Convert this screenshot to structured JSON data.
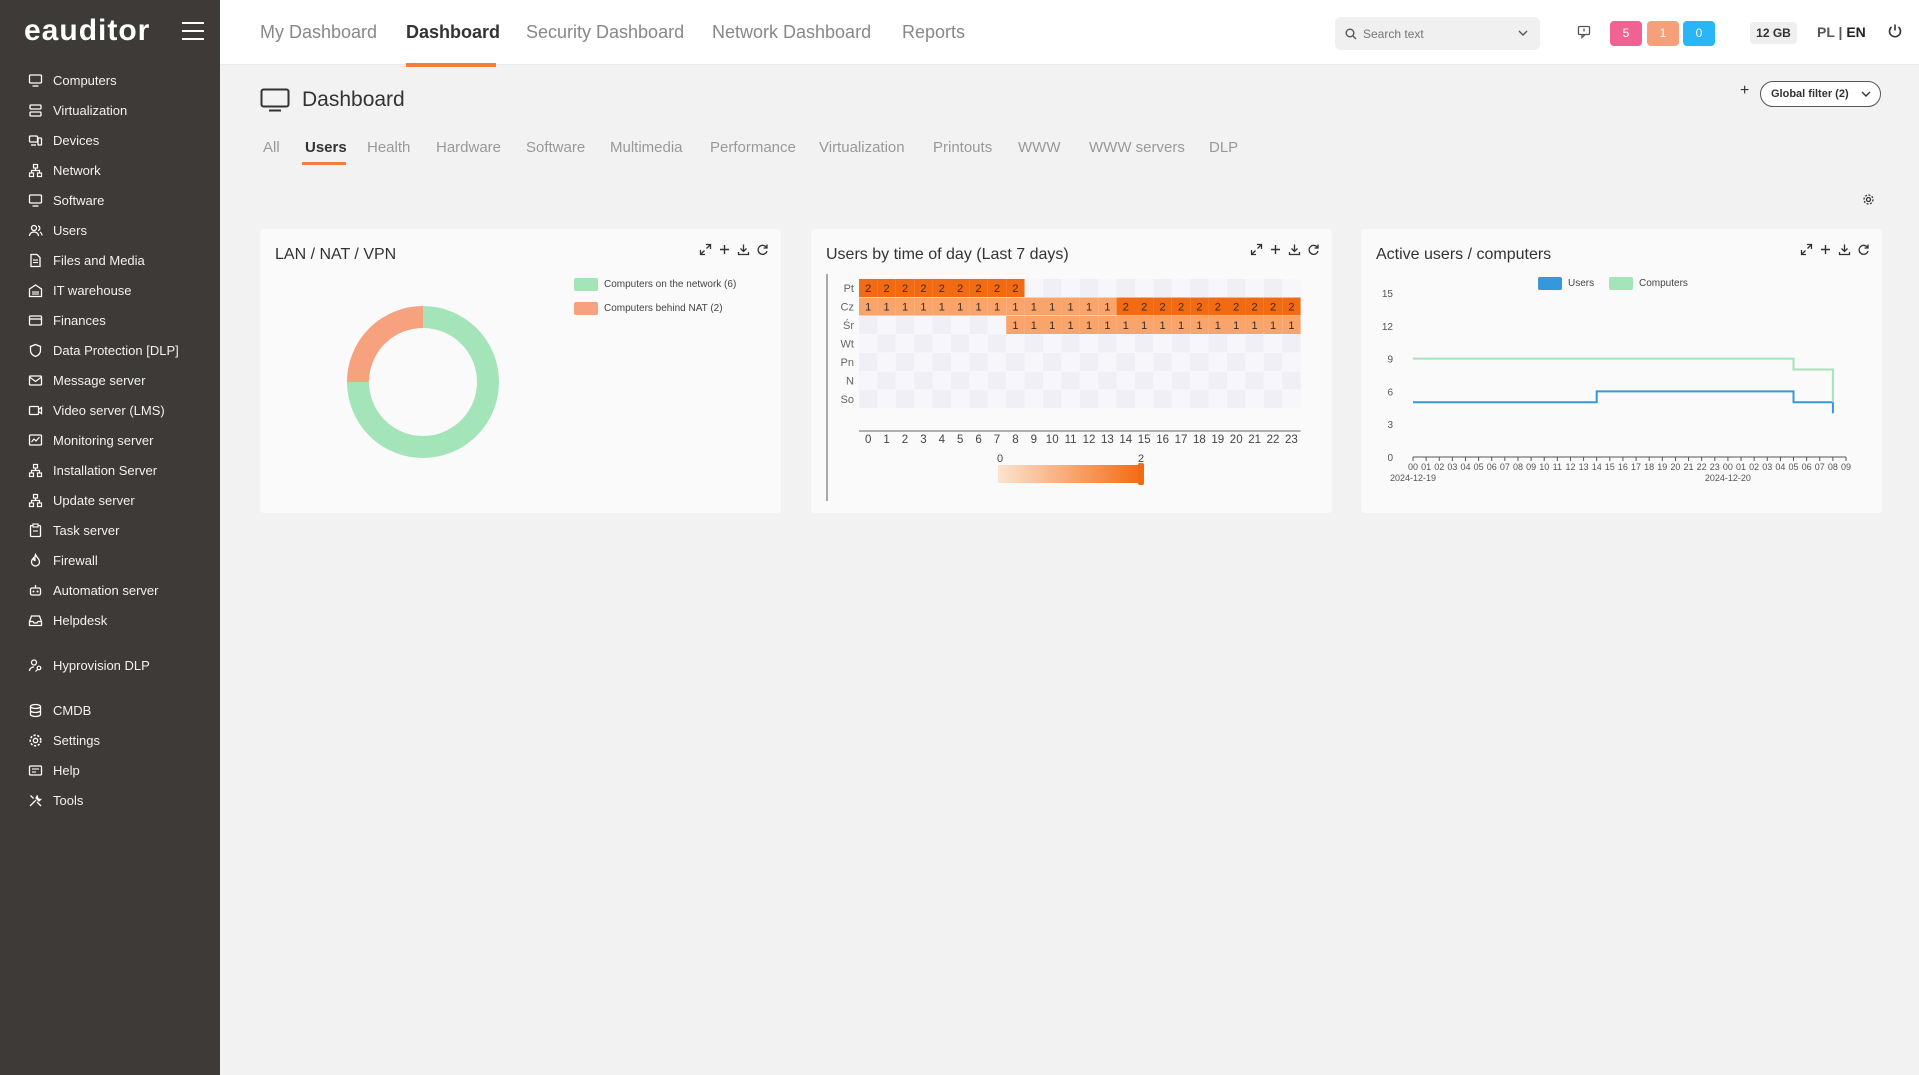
{
  "app": {
    "logo": "eauditor"
  },
  "sidebar": {
    "items": [
      {
        "label": "Computers",
        "icon": "monitor-icon"
      },
      {
        "label": "Virtualization",
        "icon": "server-icon"
      },
      {
        "label": "Devices",
        "icon": "devices-icon"
      },
      {
        "label": "Network",
        "icon": "network-icon"
      },
      {
        "label": "Software",
        "icon": "monitor-icon"
      },
      {
        "label": "Users",
        "icon": "users-icon"
      },
      {
        "label": "Files and Media",
        "icon": "file-icon"
      },
      {
        "label": "IT warehouse",
        "icon": "warehouse-icon"
      },
      {
        "label": "Finances",
        "icon": "card-icon"
      },
      {
        "label": "Data Protection [DLP]",
        "icon": "shield-icon"
      },
      {
        "label": "Message server",
        "icon": "mail-icon"
      },
      {
        "label": "Video server (LMS)",
        "icon": "video-icon"
      },
      {
        "label": "Monitoring server",
        "icon": "chart-icon"
      },
      {
        "label": "Installation Server",
        "icon": "network-icon"
      },
      {
        "label": "Update server",
        "icon": "network-icon"
      },
      {
        "label": "Task server",
        "icon": "clipboard-icon"
      },
      {
        "label": "Firewall",
        "icon": "fire-icon"
      },
      {
        "label": "Automation server",
        "icon": "robot-icon"
      },
      {
        "label": "Helpdesk",
        "icon": "inbox-icon"
      }
    ],
    "items2": [
      {
        "label": "Hyprovision DLP",
        "icon": "user-key-icon"
      }
    ],
    "items3": [
      {
        "label": "CMDB",
        "icon": "database-icon"
      },
      {
        "label": "Settings",
        "icon": "gear-icon"
      },
      {
        "label": "Help",
        "icon": "help-icon"
      },
      {
        "label": "Tools",
        "icon": "tools-icon"
      }
    ]
  },
  "topnav": {
    "tabs": [
      "My Dashboard",
      "Dashboard",
      "Security Dashboard",
      "Network Dashboard",
      "Reports"
    ],
    "active": "Dashboard",
    "search_placeholder": "Search text",
    "badges": [
      {
        "value": "5",
        "color": "#f06292"
      },
      {
        "value": "1",
        "color": "#f4a07a"
      },
      {
        "value": "0",
        "color": "#29b6f6"
      }
    ],
    "storage": "12 GB",
    "lang_pl": "PL",
    "lang_sep": " | ",
    "lang_en": "EN"
  },
  "page": {
    "title": "Dashboard",
    "global_filter": "Global filter (2)",
    "subtabs": [
      "All",
      "Users",
      "Health",
      "Hardware",
      "Software",
      "Multimedia",
      "Performance",
      "Virtualization",
      "Printouts",
      "WWW",
      "WWW servers",
      "DLP"
    ],
    "active_subtab": "Users"
  },
  "widgets": {
    "lan": {
      "title": "LAN / NAT / VPN"
    },
    "time": {
      "title": "Users by time of day (Last 7 days)"
    },
    "active": {
      "title": "Active users / computers"
    }
  },
  "colors": {
    "accent": "#f47c3c",
    "green": "#a3e4b8",
    "salmon": "#f7a27f",
    "blue": "#3498db",
    "heat_dark": "#f26a12",
    "heat_light": "#f9a46b"
  },
  "chart_data": [
    {
      "type": "pie",
      "title": "LAN / NAT / VPN",
      "donut": true,
      "legend_position": "top-right",
      "slices": [
        {
          "label": "Computers on the network (6)",
          "value": 6,
          "color": "#a3e4b8"
        },
        {
          "label": "Computers behind NAT (2)",
          "value": 2,
          "color": "#f7a27f"
        }
      ]
    },
    {
      "type": "heatmap",
      "title": "Users by time of day (Last 7 days)",
      "x": [
        "0",
        "1",
        "2",
        "3",
        "4",
        "5",
        "6",
        "7",
        "8",
        "9",
        "10",
        "11",
        "12",
        "13",
        "14",
        "15",
        "16",
        "17",
        "18",
        "19",
        "20",
        "21",
        "22",
        "23"
      ],
      "y": [
        "Pt",
        "Cz",
        "Śr",
        "Wt",
        "Pn",
        "N",
        "So"
      ],
      "rows": [
        [
          2,
          2,
          2,
          2,
          2,
          2,
          2,
          2,
          2,
          null,
          null,
          null,
          null,
          null,
          null,
          null,
          null,
          null,
          null,
          null,
          null,
          null,
          null,
          null
        ],
        [
          1,
          1,
          1,
          1,
          1,
          1,
          1,
          1,
          1,
          1,
          1,
          1,
          1,
          1,
          2,
          2,
          2,
          2,
          2,
          2,
          2,
          2,
          2,
          2
        ],
        [
          null,
          null,
          null,
          null,
          null,
          null,
          null,
          null,
          1,
          1,
          1,
          1,
          1,
          1,
          1,
          1,
          1,
          1,
          1,
          1,
          1,
          1,
          1,
          1
        ],
        [
          null,
          null,
          null,
          null,
          null,
          null,
          null,
          null,
          null,
          null,
          null,
          null,
          null,
          null,
          null,
          null,
          null,
          null,
          null,
          null,
          null,
          null,
          null,
          null
        ],
        [
          null,
          null,
          null,
          null,
          null,
          null,
          null,
          null,
          null,
          null,
          null,
          null,
          null,
          null,
          null,
          null,
          null,
          null,
          null,
          null,
          null,
          null,
          null,
          null
        ],
        [
          null,
          null,
          null,
          null,
          null,
          null,
          null,
          null,
          null,
          null,
          null,
          null,
          null,
          null,
          null,
          null,
          null,
          null,
          null,
          null,
          null,
          null,
          null,
          null
        ],
        [
          null,
          null,
          null,
          null,
          null,
          null,
          null,
          null,
          null,
          null,
          null,
          null,
          null,
          null,
          null,
          null,
          null,
          null,
          null,
          null,
          null,
          null,
          null,
          null
        ]
      ],
      "visual_map": {
        "min": "0",
        "max": "2"
      }
    },
    {
      "type": "line",
      "title": "Active users / computers",
      "ylim": [
        0,
        15
      ],
      "y_ticks": [
        "0",
        "3",
        "6",
        "9",
        "12",
        "15"
      ],
      "x_ticks": [
        "00",
        "01",
        "02",
        "03",
        "04",
        "05",
        "06",
        "07",
        "08",
        "09",
        "10",
        "11",
        "12",
        "13",
        "14",
        "15",
        "16",
        "17",
        "18",
        "19",
        "20",
        "21",
        "22",
        "23",
        "00",
        "01",
        "02",
        "03",
        "04",
        "05",
        "06",
        "07",
        "08",
        "09"
      ],
      "date_labels": [
        "2024-12-19",
        "2024-12-20"
      ],
      "legend_position": "top-center",
      "series": [
        {
          "name": "Users",
          "color": "#3498db",
          "points": [
            [
              0,
              5
            ],
            [
              14,
              5
            ],
            [
              14,
              6
            ],
            [
              29,
              6
            ],
            [
              29,
              5
            ],
            [
              32,
              5
            ],
            [
              32,
              4
            ]
          ]
        },
        {
          "name": "Computers",
          "color": "#a3e4b8",
          "points": [
            [
              0,
              9
            ],
            [
              29,
              9
            ],
            [
              29,
              8
            ],
            [
              32,
              8
            ],
            [
              32,
              5
            ]
          ]
        }
      ]
    }
  ]
}
